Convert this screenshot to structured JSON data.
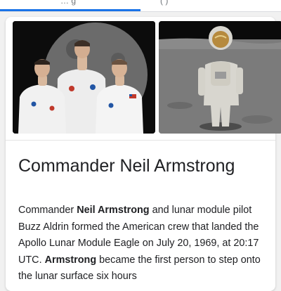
{
  "tabs": [
    {
      "label": "… g"
    },
    {
      "label": "( )"
    }
  ],
  "images": [
    {
      "alt": "Apollo 11 crew portrait"
    },
    {
      "alt": "Astronaut on the lunar surface"
    }
  ],
  "card": {
    "title": "Commander Neil Armstrong",
    "description": [
      {
        "text": "Commander ",
        "bold": false
      },
      {
        "text": "Neil Armstrong",
        "bold": true
      },
      {
        "text": " and lunar module pilot Buzz Aldrin formed the American crew that landed the Apollo Lunar Module Eagle on July 20, 1969, at 20:17 UTC. ",
        "bold": false
      },
      {
        "text": "Armstrong",
        "bold": true
      },
      {
        "text": " became the first person to step onto the lunar surface six hours",
        "bold": false
      }
    ]
  },
  "colors": {
    "accent": "#1a73e8",
    "text": "#202124",
    "muted": "#70757a"
  }
}
